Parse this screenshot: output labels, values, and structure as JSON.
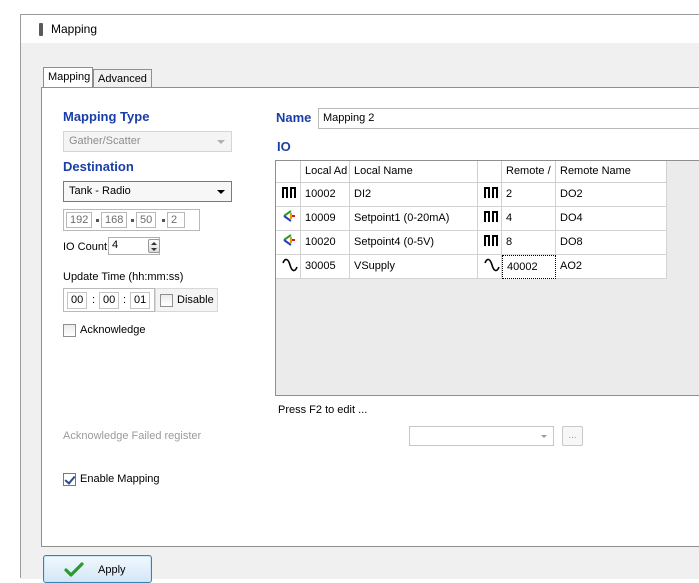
{
  "window": {
    "title": "Mapping"
  },
  "tabs": [
    {
      "label": "Mapping",
      "active": true
    },
    {
      "label": "Advanced",
      "active": false
    }
  ],
  "left": {
    "mapping_type_label": "Mapping Type",
    "mapping_type_value": "Gather/Scatter",
    "destination_label": "Destination",
    "destination_value": "Tank - Radio",
    "ip": [
      "192",
      "168",
      "50",
      "2"
    ],
    "io_count_label": "IO Count",
    "io_count_value": "4",
    "update_time_label": "Update Time  (hh:mm:ss)",
    "update_time": {
      "hh": "00",
      "mm": "00",
      "ss": "01",
      "sep": ":"
    },
    "disable_label": "Disable",
    "acknowledge_label": "Acknowledge",
    "ack_failed_label": "Acknowledge Failed register",
    "enable_mapping_label": "Enable Mapping",
    "enable_mapping_checked": true
  },
  "right": {
    "name_label": "Name",
    "name_value": "Mapping 2",
    "io_label": "IO",
    "grid": {
      "headers": [
        "",
        "Local Ad",
        "Local Name",
        "",
        "Remote /",
        "Remote Name"
      ],
      "rows": [
        {
          "local_icon": "digital-pulse-icon",
          "local_addr": "10002",
          "local_name": "DI2",
          "remote_icon": "digital-pulse-icon",
          "remote_addr": "2",
          "remote_name": "DO2"
        },
        {
          "local_icon": "analog-input-icon",
          "local_addr": "10009",
          "local_name": "Setpoint1 (0-20mA)",
          "remote_icon": "digital-pulse-icon",
          "remote_addr": "4",
          "remote_name": "DO4"
        },
        {
          "local_icon": "analog-input-icon",
          "local_addr": "10020",
          "local_name": "Setpoint4 (0-5V)",
          "remote_icon": "digital-pulse-icon",
          "remote_addr": "8",
          "remote_name": "DO8"
        },
        {
          "local_icon": "sine-wave-icon",
          "local_addr": "30005",
          "local_name": "VSupply",
          "remote_icon": "sine-wave-icon",
          "remote_addr": "40002",
          "remote_name": "AO2"
        }
      ]
    },
    "hint": "Press F2 to edit ...",
    "ellipsis_label": "..."
  },
  "apply_label": "Apply",
  "colors": {
    "section_blue": "#1a3ea8",
    "apply_check": "#2c9a2c",
    "button_border": "#3c7fb1"
  }
}
